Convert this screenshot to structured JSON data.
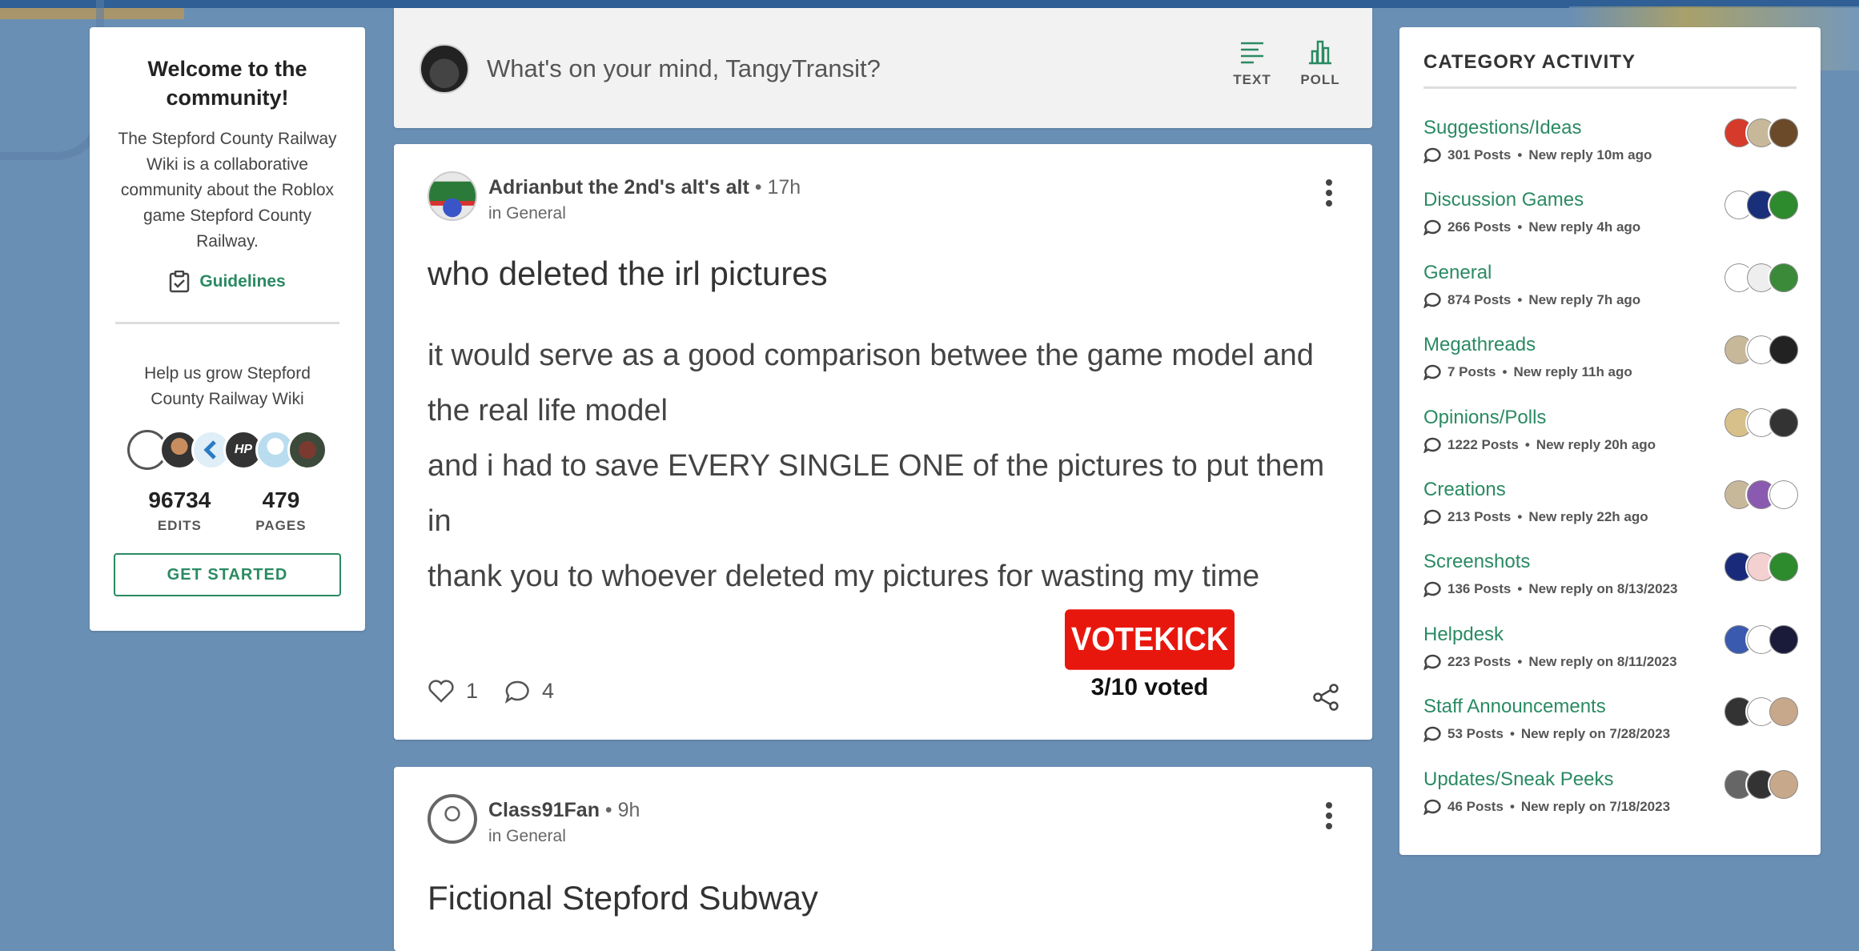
{
  "welcome": {
    "title": "Welcome to the community!",
    "description": "The Stepford County Railway Wiki is a collaborative community about the Roblox game Stepford County Railway.",
    "guidelines_label": "Guidelines",
    "help_text": "Help us grow Stepford County Railway Wiki",
    "edits_count": "96734",
    "edits_label": "EDITS",
    "pages_count": "479",
    "pages_label": "PAGES",
    "get_started_label": "GET STARTED"
  },
  "composer": {
    "placeholder": "What's on your mind, TangyTransit?",
    "text_label": "TEXT",
    "poll_label": "POLL"
  },
  "posts": [
    {
      "author": "Adrianbut the 2nd's alt's alt",
      "time": "17h",
      "category": "in General",
      "title": "who deleted the irl pictures",
      "body": [
        " it would serve as a good comparison betwee the game model and the real life model",
        " and i had to save EVERY SINGLE ONE of the pictures to put them in",
        " thank you to whoever deleted my pictures for wasting my time"
      ],
      "likes": "1",
      "comments": "4"
    },
    {
      "author": "Class91Fan",
      "time": "9h",
      "category": "in General",
      "title": "Fictional Stepford Subway"
    }
  ],
  "overlay": {
    "votekick_label": "VOTEKICK",
    "voted_text": "3/10 voted"
  },
  "activity": {
    "title": "CATEGORY ACTIVITY",
    "categories": [
      {
        "name": "Suggestions/Ideas",
        "posts": "301 Posts",
        "reply": "New reply 10m ago"
      },
      {
        "name": "Discussion Games",
        "posts": "266 Posts",
        "reply": "New reply 4h ago"
      },
      {
        "name": "General",
        "posts": "874 Posts",
        "reply": "New reply 7h ago"
      },
      {
        "name": "Megathreads",
        "posts": "7 Posts",
        "reply": "New reply 11h ago"
      },
      {
        "name": "Opinions/Polls",
        "posts": "1222 Posts",
        "reply": "New reply 20h ago"
      },
      {
        "name": "Creations",
        "posts": "213 Posts",
        "reply": "New reply 22h ago"
      },
      {
        "name": "Screenshots",
        "posts": "136 Posts",
        "reply": "New reply on 8/13/2023"
      },
      {
        "name": "Helpdesk",
        "posts": "223 Posts",
        "reply": "New reply on 8/11/2023"
      },
      {
        "name": "Staff Announcements",
        "posts": "53 Posts",
        "reply": "New reply on 7/28/2023"
      },
      {
        "name": "Updates/Sneak Peeks",
        "posts": "46 Posts",
        "reply": "New reply on 7/18/2023"
      }
    ]
  },
  "colors": {
    "accent": "#2a8a63",
    "votekick": "#e8170d",
    "background": "#6a8fb5"
  }
}
